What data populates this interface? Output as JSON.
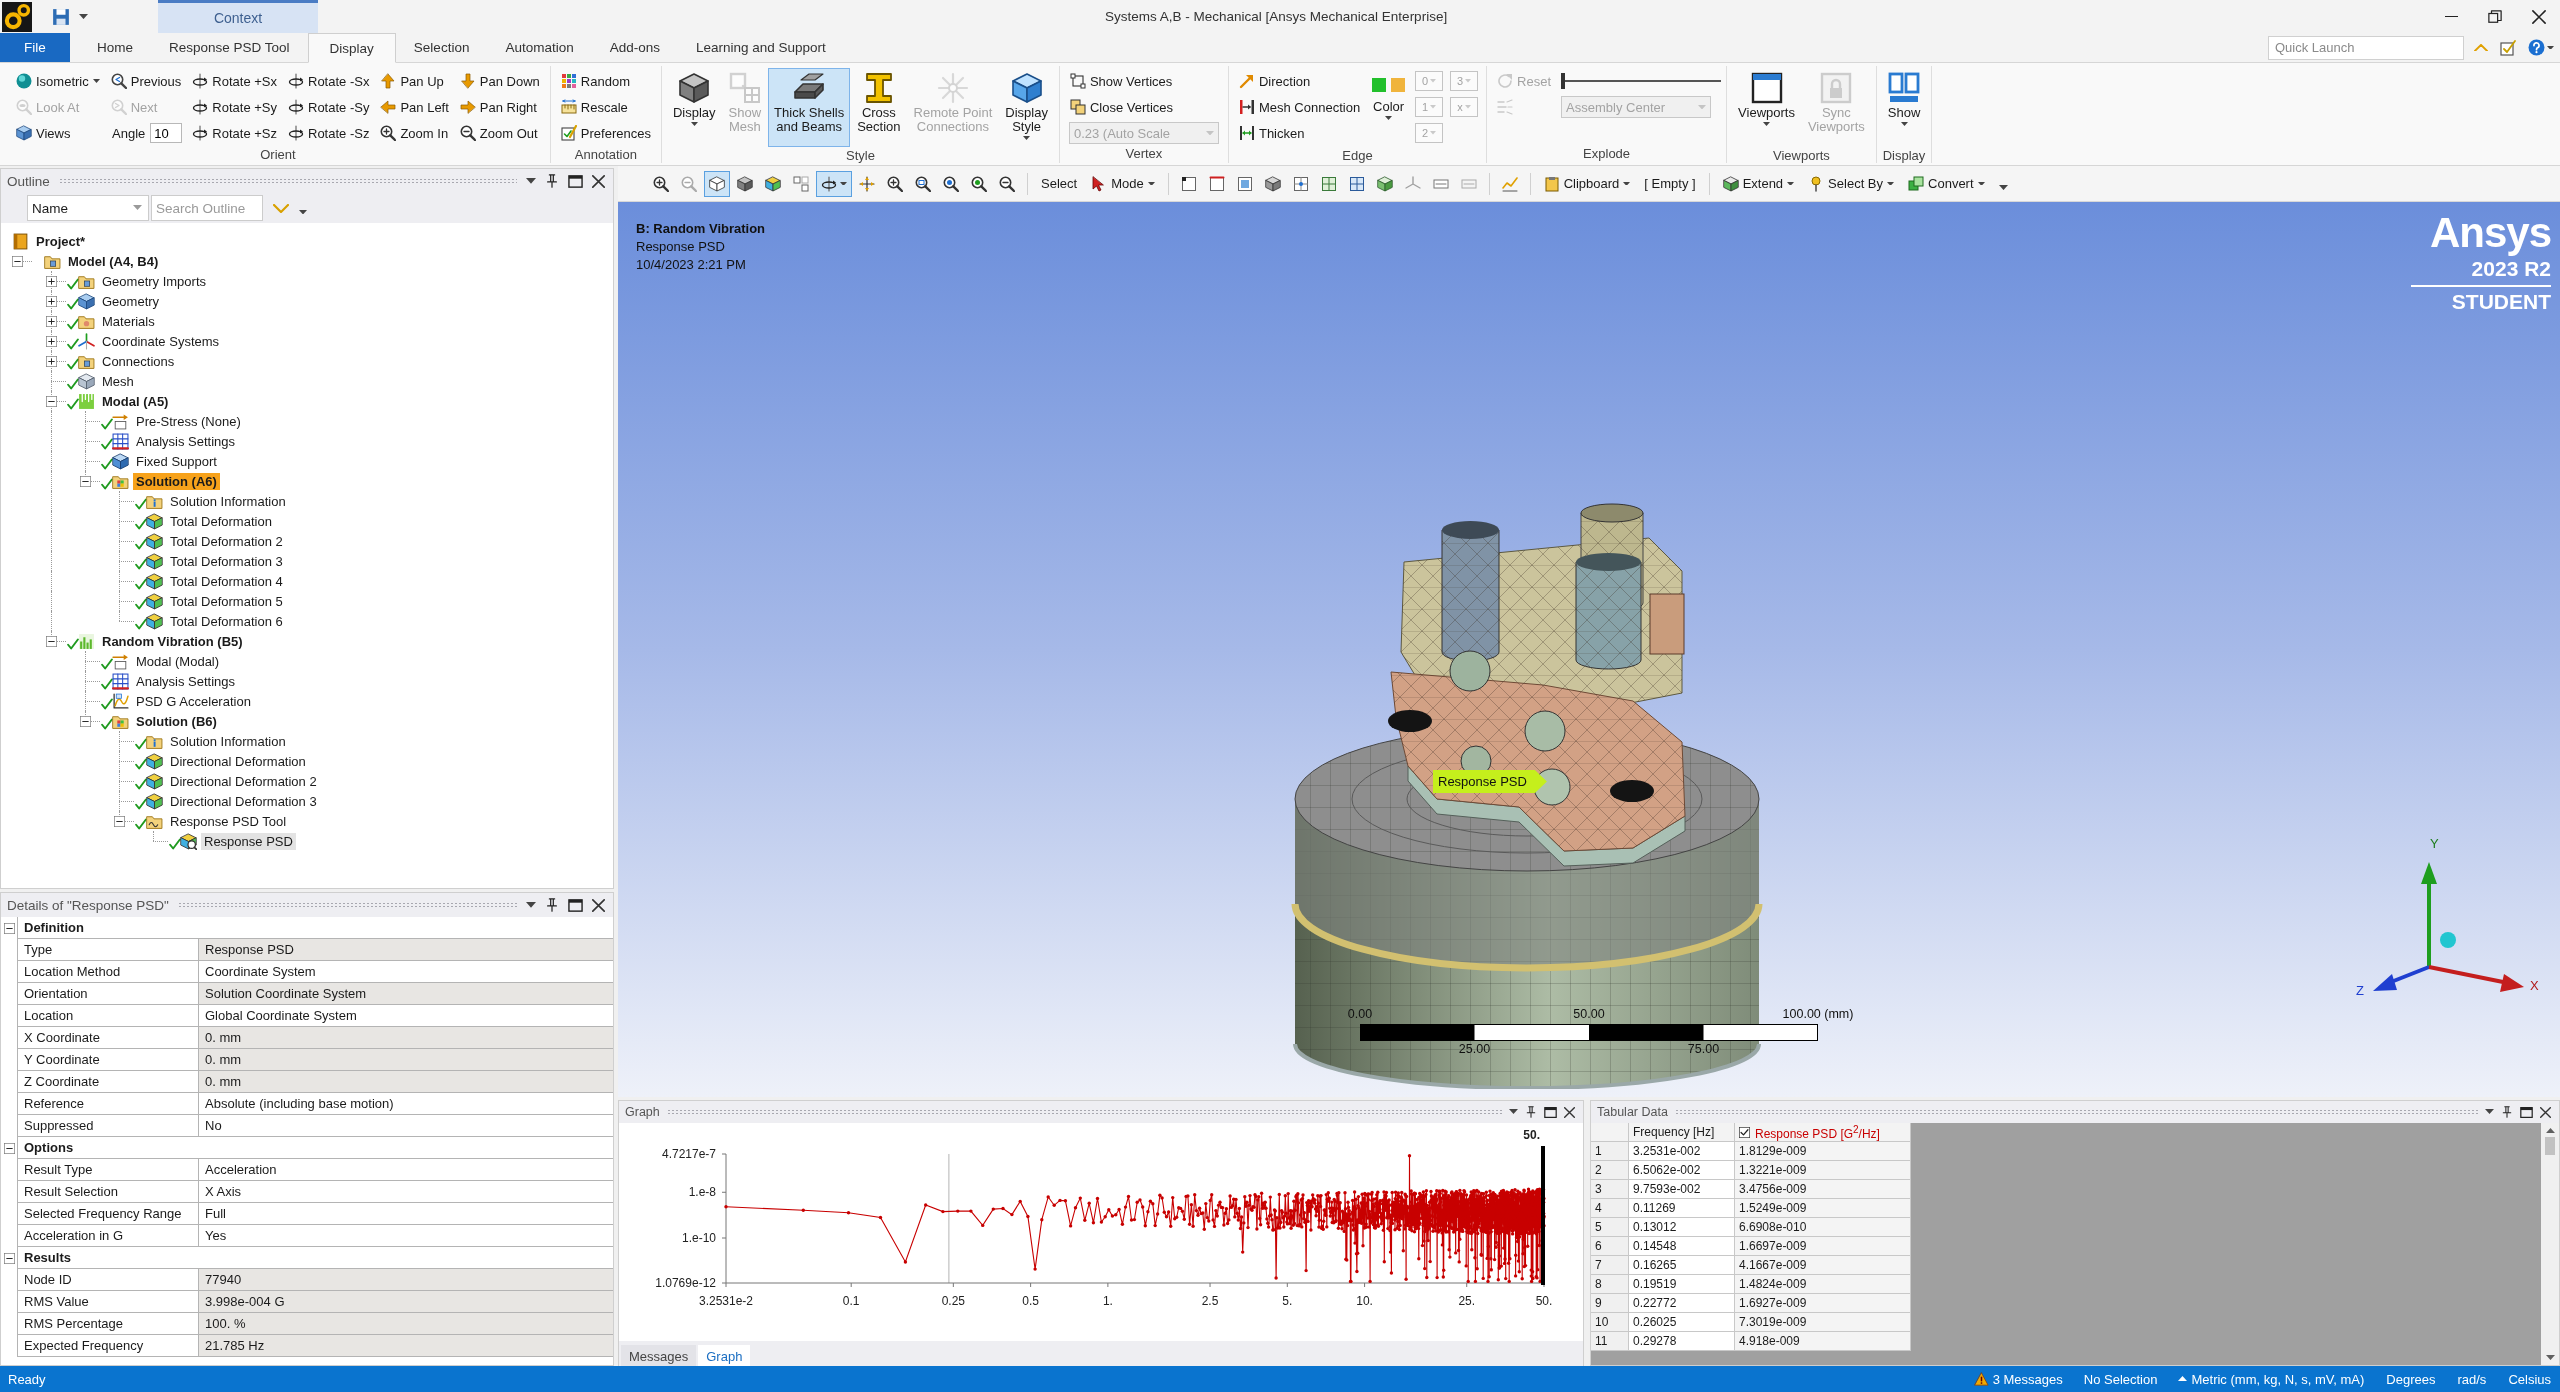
{
  "window": {
    "title": "Systems A,B - Mechanical [Ansys Mechanical Enterprise]",
    "context_label": "Context"
  },
  "ribbon": {
    "tabs": [
      {
        "label": "File",
        "kind": "file",
        "selected": false
      },
      {
        "label": "Home",
        "kind": "tab",
        "selected": false
      },
      {
        "label": "Response PSD Tool",
        "kind": "tab",
        "selected": false
      },
      {
        "label": "Display",
        "kind": "tab",
        "selected": true
      },
      {
        "label": "Selection",
        "kind": "tab",
        "selected": false
      },
      {
        "label": "Automation",
        "kind": "tab",
        "selected": false
      },
      {
        "label": "Add-ons",
        "kind": "tab",
        "selected": false
      },
      {
        "label": "Learning and Support",
        "kind": "tab",
        "selected": false
      }
    ],
    "quick_launch": {
      "placeholder": "Quick Launch"
    },
    "groups": [
      {
        "label": "Orient",
        "columns": [
          [
            {
              "kind": "small",
              "label": "Isometric",
              "menu": true,
              "disabled": false
            },
            {
              "kind": "small",
              "label": "Look At",
              "menu": false,
              "disabled": true
            },
            {
              "kind": "small",
              "label": "Views",
              "menu": false,
              "disabled": false
            }
          ],
          [
            {
              "kind": "small",
              "label": "Previous",
              "menu": false,
              "disabled": false
            },
            {
              "kind": "small",
              "label": "Next",
              "menu": false,
              "disabled": true
            },
            {
              "kind": "field",
              "label": "Angle",
              "value": "10"
            }
          ],
          [
            {
              "kind": "small",
              "label": "Rotate +Sx",
              "menu": false,
              "disabled": false
            },
            {
              "kind": "small",
              "label": "Rotate +Sy",
              "menu": false,
              "disabled": false
            },
            {
              "kind": "small",
              "label": "Rotate +Sz",
              "menu": false,
              "disabled": false
            }
          ],
          [
            {
              "kind": "small",
              "label": "Rotate -Sx",
              "menu": false,
              "disabled": false
            },
            {
              "kind": "small",
              "label": "Rotate -Sy",
              "menu": false,
              "disabled": false
            },
            {
              "kind": "small",
              "label": "Rotate -Sz",
              "menu": false,
              "disabled": false
            }
          ],
          [
            {
              "kind": "small",
              "label": "Pan Up",
              "menu": false,
              "disabled": false
            },
            {
              "kind": "small",
              "label": "Pan Left",
              "menu": false,
              "disabled": false
            },
            {
              "kind": "small",
              "label": "Zoom In",
              "menu": false,
              "disabled": false
            }
          ],
          [
            {
              "kind": "small",
              "label": "Pan Down",
              "menu": false,
              "disabled": false
            },
            {
              "kind": "small",
              "label": "Pan Right",
              "menu": false,
              "disabled": false
            },
            {
              "kind": "small",
              "label": "Zoom Out",
              "menu": false,
              "disabled": false
            }
          ]
        ]
      },
      {
        "label": "Annotation",
        "columns": [
          [
            {
              "kind": "small",
              "label": "Random",
              "menu": false,
              "disabled": false
            },
            {
              "kind": "small",
              "label": "Rescale",
              "menu": false,
              "disabled": false
            },
            {
              "kind": "small",
              "label": "Preferences",
              "menu": false,
              "disabled": false
            }
          ]
        ]
      },
      {
        "label": "Style",
        "columns": [
          [
            {
              "kind": "large",
              "label": "Display",
              "menu": true,
              "disabled": false,
              "selected": false
            }
          ],
          [
            {
              "kind": "large",
              "label": "Show\nMesh",
              "menu": false,
              "disabled": true,
              "selected": false
            }
          ],
          [
            {
              "kind": "large",
              "label": "Thick Shells\nand Beams",
              "menu": false,
              "disabled": false,
              "selected": true
            }
          ],
          [
            {
              "kind": "large",
              "label": "Cross\nSection",
              "menu": false,
              "disabled": false,
              "selected": false
            }
          ],
          [
            {
              "kind": "large",
              "label": "Remote Point\nConnections",
              "menu": false,
              "disabled": true,
              "selected": false
            }
          ],
          [
            {
              "kind": "large",
              "label": "Display\nStyle",
              "menu": true,
              "disabled": false,
              "selected": false
            }
          ]
        ]
      },
      {
        "label": "Vertex",
        "columns": [
          [
            {
              "kind": "small",
              "label": "Show Vertices",
              "menu": false,
              "disabled": false
            },
            {
              "kind": "small",
              "label": "Close Vertices",
              "menu": false,
              "disabled": false
            },
            {
              "kind": "dropdown",
              "value": "0.23 (Auto Scale",
              "disabled": true
            }
          ]
        ]
      },
      {
        "label": "Edge",
        "columns": [
          [
            {
              "kind": "small",
              "label": "Direction",
              "menu": false,
              "disabled": false
            },
            {
              "kind": "small",
              "label": "Mesh Connection",
              "menu": false,
              "disabled": false
            },
            {
              "kind": "small",
              "label": "Thicken",
              "menu": false,
              "disabled": false
            }
          ],
          [
            {
              "kind": "color",
              "label": "Color",
              "menu": true,
              "disabled": false,
              "swatches": [
                {
                  "color": "#22c02c"
                },
                {
                  "color": "#f0b43c"
                }
              ]
            }
          ],
          [
            {
              "kind": "mini",
              "label": "0",
              "disabled": true
            },
            {
              "kind": "mini",
              "label": "1",
              "disabled": true
            },
            {
              "kind": "mini",
              "label": "2",
              "disabled": true
            }
          ],
          [
            {
              "kind": "mini",
              "label": "3",
              "disabled": true
            },
            {
              "kind": "mini",
              "label": "x",
              "disabled": true
            }
          ]
        ]
      },
      {
        "label": "Explode",
        "columns": [
          [
            {
              "kind": "small",
              "label": "Reset",
              "menu": false,
              "disabled": true
            },
            {
              "kind": "icon",
              "disabled": true
            }
          ],
          [
            {
              "kind": "slider",
              "level": 0
            },
            {
              "kind": "dropdown",
              "value": "Assembly Center",
              "disabled": true
            }
          ]
        ]
      },
      {
        "label": "Viewports",
        "columns": [
          [
            {
              "kind": "large",
              "label": "Viewports",
              "menu": true,
              "disabled": false,
              "selected": false
            }
          ],
          [
            {
              "kind": "large",
              "label": "Sync\nViewports",
              "menu": false,
              "disabled": true,
              "selected": false
            }
          ]
        ]
      },
      {
        "label": "Display",
        "columns": [
          [
            {
              "kind": "large",
              "label": "Show",
              "menu": true,
              "disabled": false,
              "selected": false
            }
          ]
        ]
      }
    ]
  },
  "view_toolbar": {
    "tools": [
      {
        "selected": false
      },
      {
        "selected": false
      },
      {
        "selected": true
      },
      {
        "selected": false
      },
      {
        "selected": false
      },
      {
        "selected": false
      },
      {
        "selected": true
      },
      {
        "selected": false
      },
      {
        "selected": false
      },
      {
        "selected": false
      },
      {
        "selected": false
      },
      {
        "selected": false
      },
      {
        "selected": false
      }
    ],
    "select_label": "Select",
    "mode": {
      "label": "Mode"
    },
    "filters": [
      {
        "selected": false
      },
      {
        "selected": false
      },
      {
        "selected": false
      },
      {
        "selected": false
      },
      {
        "selected": false
      },
      {
        "selected": false
      },
      {
        "selected": false
      },
      {
        "selected": false
      },
      {
        "selected": false
      },
      {
        "selected": false
      },
      {
        "selected": false
      }
    ],
    "clipboard": {
      "label": "Clipboard"
    },
    "clipboard_state": "[ Empty ]",
    "extend": {
      "label": "Extend"
    },
    "select_by": {
      "label": "Select By"
    },
    "convert": {
      "label": "Convert"
    }
  },
  "outline": {
    "title": "Outline",
    "filter_field": {
      "value": "Name"
    },
    "search_field": {
      "placeholder": "Search Outline"
    },
    "tree": [
      {
        "label": "Project*",
        "kind": "project",
        "status_ok": false,
        "selected": false,
        "highlighted": false,
        "children": [
          {
            "label": "Model (A4, B4)",
            "kind": "model",
            "status_ok": false,
            "selected": false,
            "highlighted": false,
            "expanded": true,
            "children": [
              {
                "label": "Geometry Imports",
                "kind": "imports",
                "status_ok": true,
                "selected": false,
                "highlighted": false,
                "expanded": false
              },
              {
                "label": "Geometry",
                "kind": "geometry",
                "status_ok": true,
                "selected": false,
                "highlighted": false,
                "expanded": false
              },
              {
                "label": "Materials",
                "kind": "materials",
                "status_ok": true,
                "selected": false,
                "highlighted": false,
                "expanded": false
              },
              {
                "label": "Coordinate Systems",
                "kind": "coordinates",
                "status_ok": true,
                "selected": false,
                "highlighted": false,
                "expanded": false
              },
              {
                "label": "Connections",
                "kind": "connections",
                "status_ok": true,
                "selected": false,
                "highlighted": false,
                "expanded": false
              },
              {
                "label": "Mesh",
                "kind": "mesh",
                "status_ok": true,
                "selected": false,
                "highlighted": false
              },
              {
                "label": "Modal (A5)",
                "kind": "modal",
                "status_ok": true,
                "selected": false,
                "highlighted": false,
                "expanded": true,
                "children": [
                  {
                    "label": "Pre-Stress (None)",
                    "kind": "initial",
                    "status_ok": true,
                    "selected": false,
                    "highlighted": false
                  },
                  {
                    "label": "Analysis Settings",
                    "kind": "settings",
                    "status_ok": true,
                    "selected": false,
                    "highlighted": false
                  },
                  {
                    "label": "Fixed Support",
                    "kind": "support",
                    "status_ok": true,
                    "selected": false,
                    "highlighted": false
                  },
                  {
                    "label": "Solution (A6)",
                    "kind": "solution",
                    "status_ok": true,
                    "selected": false,
                    "highlighted": true,
                    "expanded": true,
                    "children": [
                      {
                        "label": "Solution Information",
                        "kind": "info",
                        "status_ok": true,
                        "selected": false,
                        "highlighted": false
                      },
                      {
                        "label": "Total Deformation",
                        "kind": "result",
                        "status_ok": true,
                        "selected": false,
                        "highlighted": false
                      },
                      {
                        "label": "Total Deformation 2",
                        "kind": "result",
                        "status_ok": true,
                        "selected": false,
                        "highlighted": false
                      },
                      {
                        "label": "Total Deformation 3",
                        "kind": "result",
                        "status_ok": true,
                        "selected": false,
                        "highlighted": false
                      },
                      {
                        "label": "Total Deformation 4",
                        "kind": "result",
                        "status_ok": true,
                        "selected": false,
                        "highlighted": false
                      },
                      {
                        "label": "Total Deformation 5",
                        "kind": "result",
                        "status_ok": true,
                        "selected": false,
                        "highlighted": false
                      },
                      {
                        "label": "Total Deformation 6",
                        "kind": "result",
                        "status_ok": true,
                        "selected": false,
                        "highlighted": false
                      }
                    ]
                  }
                ]
              },
              {
                "label": "Random Vibration (B5)",
                "kind": "random",
                "status_ok": true,
                "selected": false,
                "highlighted": false,
                "expanded": true,
                "children": [
                  {
                    "label": "Modal (Modal)",
                    "kind": "initial",
                    "status_ok": true,
                    "selected": false,
                    "highlighted": false
                  },
                  {
                    "label": "Analysis Settings",
                    "kind": "settings",
                    "status_ok": true,
                    "selected": false,
                    "highlighted": false
                  },
                  {
                    "label": "PSD G Acceleration",
                    "kind": "load",
                    "status_ok": true,
                    "selected": false,
                    "highlighted": false
                  },
                  {
                    "label": "Solution (B6)",
                    "kind": "solution",
                    "status_ok": true,
                    "selected": false,
                    "highlighted": false,
                    "expanded": true,
                    "children": [
                      {
                        "label": "Solution Information",
                        "kind": "info",
                        "status_ok": true,
                        "selected": false,
                        "highlighted": false
                      },
                      {
                        "label": "Directional Deformation",
                        "kind": "result",
                        "status_ok": true,
                        "selected": false,
                        "highlighted": false
                      },
                      {
                        "label": "Directional Deformation 2",
                        "kind": "result",
                        "status_ok": true,
                        "selected": false,
                        "highlighted": false
                      },
                      {
                        "label": "Directional Deformation 3",
                        "kind": "result",
                        "status_ok": true,
                        "selected": false,
                        "highlighted": false
                      },
                      {
                        "label": "Response PSD Tool",
                        "kind": "tool",
                        "status_ok": true,
                        "selected": false,
                        "highlighted": false,
                        "expanded": true,
                        "children": [
                          {
                            "label": "Response PSD",
                            "kind": "probe",
                            "status_ok": true,
                            "selected": true,
                            "highlighted": false
                          }
                        ]
                      }
                    ]
                  }
                ]
              }
            ]
          }
        ]
      }
    ]
  },
  "details": {
    "title": "Details of \"Response PSD\"",
    "sections": [
      {
        "title": "Definition",
        "expanded": true,
        "rows": [
          {
            "label": "Type",
            "value": "Response PSD",
            "read_only": true
          },
          {
            "label": "Location Method",
            "value": "Coordinate System",
            "read_only": false
          },
          {
            "label": "Orientation",
            "value": "Solution Coordinate System",
            "read_only": true
          },
          {
            "label": "Location",
            "value": "Global Coordinate System",
            "read_only": false
          },
          {
            "label": "X Coordinate",
            "value": "0. mm",
            "read_only": true
          },
          {
            "label": "Y Coordinate",
            "value": "0. mm",
            "read_only": true
          },
          {
            "label": "Z Coordinate",
            "value": "0. mm",
            "read_only": true
          },
          {
            "label": "Reference",
            "value": "Absolute (including base motion)",
            "read_only": false
          },
          {
            "label": "Suppressed",
            "value": "No",
            "read_only": false
          }
        ]
      },
      {
        "title": "Options",
        "expanded": true,
        "rows": [
          {
            "label": "Result Type",
            "value": "Acceleration",
            "read_only": false
          },
          {
            "label": "Result Selection",
            "value": "X Axis",
            "read_only": false
          },
          {
            "label": "Selected Frequency Range",
            "value": "Full",
            "read_only": false
          },
          {
            "label": "Acceleration in G",
            "value": "Yes",
            "read_only": false
          }
        ]
      },
      {
        "title": "Results",
        "expanded": true,
        "rows": [
          {
            "label": "Node ID",
            "value": "77940",
            "read_only": true
          },
          {
            "label": "RMS Value",
            "value": "3.998e-004 G",
            "read_only": true
          },
          {
            "label": "RMS Percentage",
            "value": "100. %",
            "read_only": true
          },
          {
            "label": "Expected Frequency",
            "value": "21.785 Hz",
            "read_only": true
          }
        ]
      }
    ]
  },
  "viewport": {
    "title": "B: Random Vibration",
    "subtitle": "Response PSD",
    "timestamp": "10/4/2023 2:21 PM",
    "logo": {
      "wordmark": "Ansys",
      "version": "2023 R2",
      "edition": "STUDENT"
    },
    "probe_label": "Response PSD",
    "scale_bar": {
      "top_labels": [
        "0.00",
        "50.00",
        "100.00 (mm)"
      ],
      "bottom_labels": [
        "25.00",
        "75.00"
      ]
    },
    "triad": {
      "x": "X",
      "y": "Y",
      "z": "Z"
    }
  },
  "graph_panel": {
    "title": "Graph",
    "y_labels": [
      "4.7217e-7",
      "1.e-8",
      "1.e-10",
      "1.0769e-12"
    ],
    "x_labels": [
      "3.2531e-2",
      "0.1",
      "0.25",
      "0.5",
      "1.",
      "2.5",
      "5.",
      "10.",
      "25.",
      "50."
    ],
    "cursor_label": "50.",
    "tabs": [
      {
        "label": "Messages",
        "selected": false
      },
      {
        "label": "Graph",
        "selected": true
      }
    ]
  },
  "tabular_panel": {
    "title": "Tabular Data",
    "columns": [
      {
        "kind": "index"
      },
      {
        "label": "Frequency [Hz]",
        "kind": "text"
      },
      {
        "label": "Response PSD [G$^{2}$/Hz]",
        "kind": "toggle",
        "checked": true
      }
    ],
    "rows": [
      [
        "1",
        "3.2531e-002",
        "1.8129e-009"
      ],
      [
        "2",
        "6.5062e-002",
        "1.3221e-009"
      ],
      [
        "3",
        "9.7593e-002",
        "3.4756e-009"
      ],
      [
        "4",
        "0.11269",
        "1.5249e-009"
      ],
      [
        "5",
        "0.13012",
        "6.6908e-010"
      ],
      [
        "6",
        "0.14548",
        "1.6697e-009"
      ],
      [
        "7",
        "0.16265",
        "4.1667e-009"
      ],
      [
        "8",
        "0.19519",
        "1.4824e-009"
      ],
      [
        "9",
        "0.22772",
        "1.6927e-009"
      ],
      [
        "10",
        "0.26025",
        "7.3019e-009"
      ],
      [
        "11",
        "0.29278",
        "4.918e-009"
      ]
    ]
  },
  "status_bar": {
    "text": "Ready",
    "messages": "3 Messages",
    "selection": "No Selection",
    "units": "Metric (mm, kg, N, s, mV, mA)",
    "angle": "Degrees",
    "rate": "rad/s",
    "temperature": "Celsius"
  }
}
